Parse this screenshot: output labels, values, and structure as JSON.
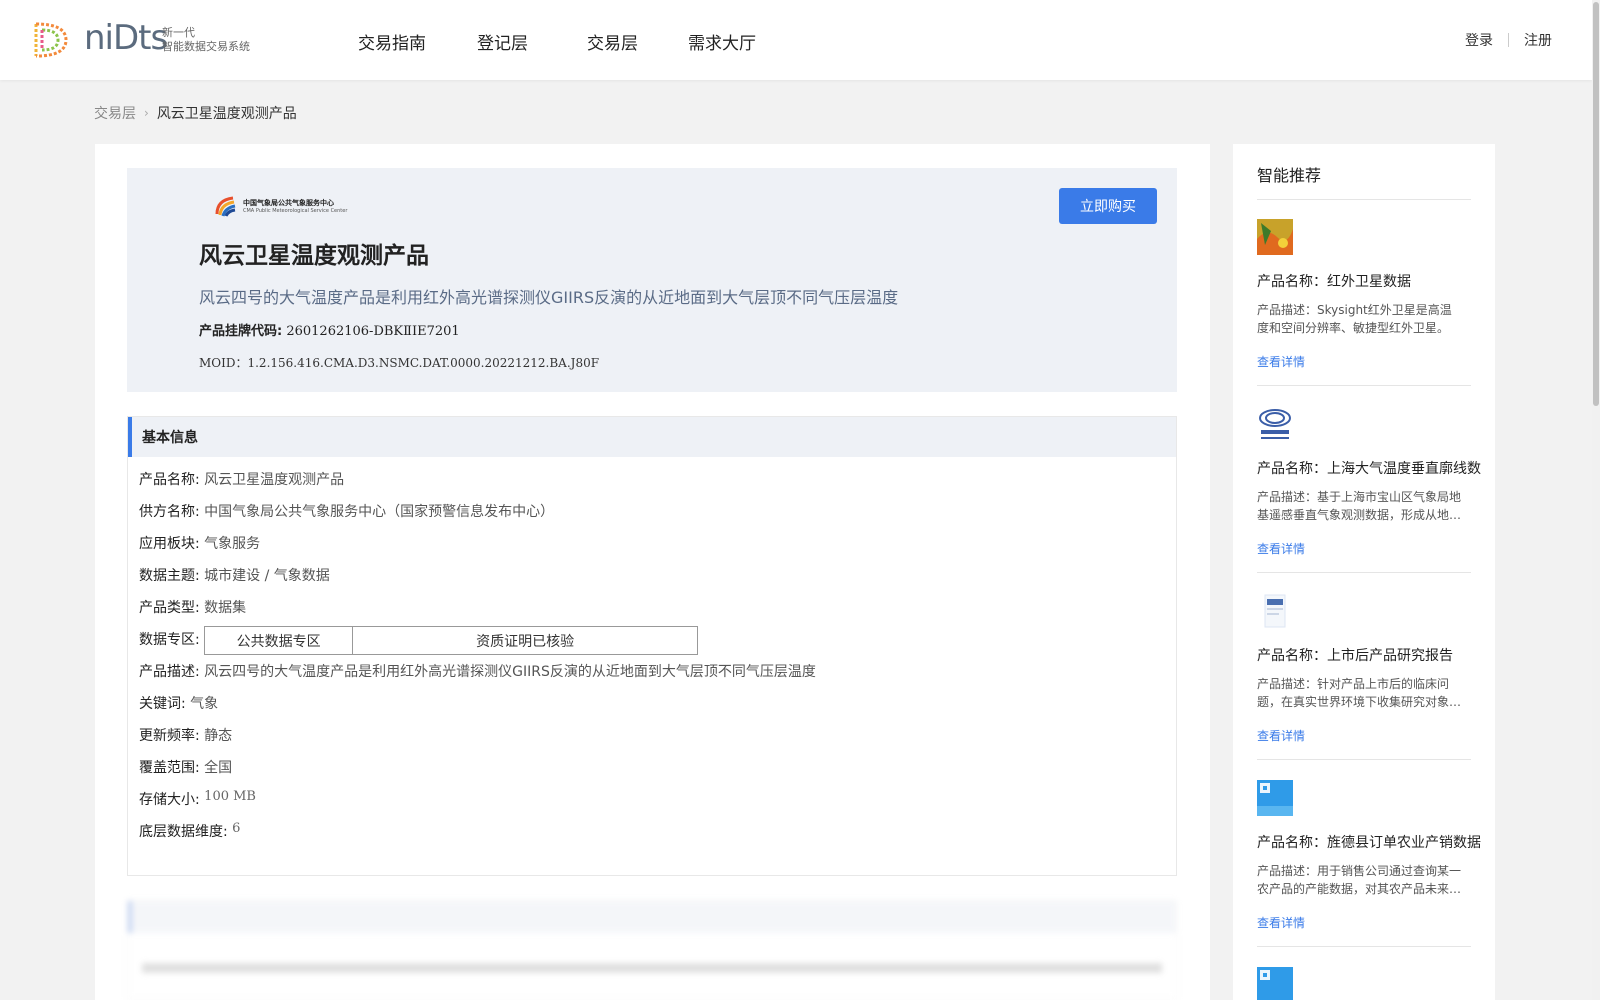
{
  "header": {
    "logo": {
      "word": "niDts",
      "tag_line1": "新一代",
      "tag_line2": "智能数据交易系统"
    },
    "nav": [
      "交易指南",
      "登记层",
      "交易层",
      "需求大厅"
    ],
    "login": "登录",
    "register": "注册"
  },
  "breadcrumb": {
    "parent": "交易层",
    "current": "风云卫星温度观测产品"
  },
  "product": {
    "supplier_logo_cn": "中国气象局公共气象服务中心",
    "supplier_logo_en": "CMA Public Meteorological Service Center",
    "title": "风云卫星温度观测产品",
    "description": "风云四号的大气温度产品是利用红外高光谱探测仪GIIRS反演的从近地面到大气层顶不同气压层温度",
    "code_label": "产品挂牌代码:",
    "code_value": "2601262106-DBKⅡIE7201",
    "moid": "MOID：1.2.156.416.CMA.D3.NSMC.DAT.0000.20221212.BA.J80F",
    "buy_label": "立即购买"
  },
  "basic_info": {
    "heading": "基本信息",
    "rows": [
      {
        "k": "产品名称:",
        "v": "风云卫星温度观测产品"
      },
      {
        "k": "供方名称:",
        "v": "中国气象局公共气象服务中心（国家预警信息发布中心）"
      },
      {
        "k": "应用板块:",
        "v": "气象服务"
      },
      {
        "k": "数据主题:",
        "v": "城市建设 / 气象数据"
      },
      {
        "k": "产品类型:",
        "v": "数据集"
      }
    ],
    "zone_label": "数据专区:",
    "zone_cells": [
      "公共数据专区",
      "资质证明已核验"
    ],
    "rows2": [
      {
        "k": "产品描述:",
        "v": "风云四号的大气温度产品是利用红外高光谱探测仪GIIRS反演的从近地面到大气层顶不同气压层温度"
      },
      {
        "k": "关键词:",
        "v": "气象"
      },
      {
        "k": "更新频率:",
        "v": "静态"
      },
      {
        "k": "覆盖范围:",
        "v": "全国"
      },
      {
        "k": "存储大小:",
        "v": "100 MB"
      },
      {
        "k": "底层数据维度:",
        "v": "6"
      }
    ]
  },
  "sidebar": {
    "title": "智能推荐",
    "items": [
      {
        "name": "产品名称：红外卫星数据",
        "desc": "产品描述：Skysight红外卫星是高温度和空间分辨率、敏捷型红外卫星。具…",
        "more": "查看详情",
        "thumb_color": "#c8a22a"
      },
      {
        "name": "产品名称：上海大气温度垂直廓线数",
        "desc": "产品描述：基于上海市宝山区气象局地基遥感垂直气象观测数据，形成从地…",
        "more": "查看详情",
        "thumb_color": "#3b5ea8"
      },
      {
        "name": "产品名称：上市后产品研究报告",
        "desc": "产品描述：针对产品上市后的临床问题，在真实世界环境下收集研究对象…",
        "more": "查看详情",
        "thumb_color": "#dde6f3"
      },
      {
        "name": "产品名称：旌德县订单农业产销数据",
        "desc": "产品描述：用于销售公司通过查询某一农产品的产能数据，对其农产品未来…",
        "more": "查看详情",
        "thumb_color": "#2f9be8"
      }
    ]
  }
}
